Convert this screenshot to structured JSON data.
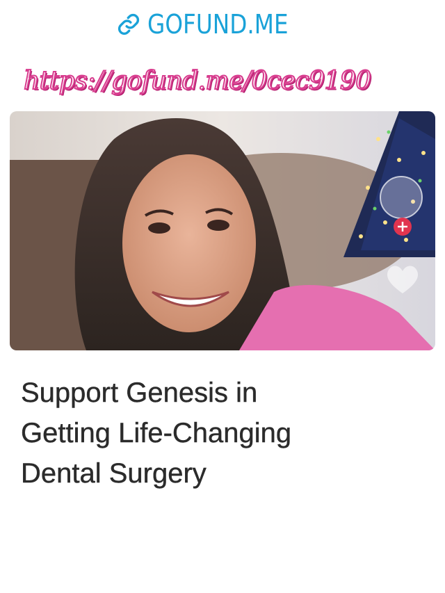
{
  "header": {
    "brand_label": "GOFUND.ME",
    "brand_icon": "link-icon",
    "brand_color": "#1aa2d8"
  },
  "link": {
    "url_text": "https://gofund.me/0cec9190",
    "color": "#d83c8e"
  },
  "media": {
    "icons": [
      "heart-icon",
      "plus-icon",
      "avatar"
    ]
  },
  "campaign": {
    "title_lines": [
      "Support Genesis in",
      "Getting Life-Changing",
      "Dental Surgery"
    ]
  }
}
